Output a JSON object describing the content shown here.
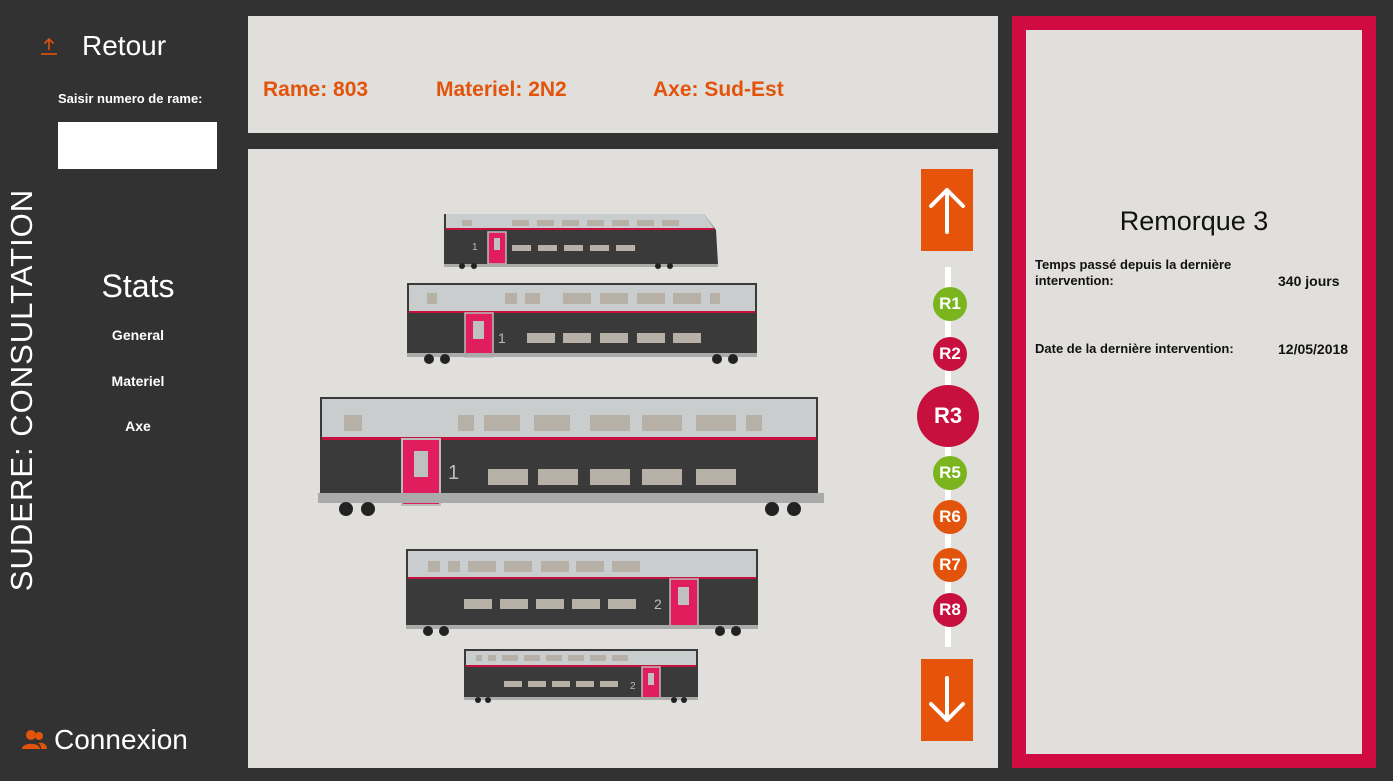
{
  "sidebar": {
    "back_label": "Retour",
    "rame_input_label": "Saisir numero de rame:",
    "rame_input_value": "",
    "app_title": "SUDERE: CONSULTATION",
    "stats_title": "Stats",
    "stats_items": [
      "General",
      "Materiel",
      "Axe"
    ],
    "connexion_label": "Connexion"
  },
  "header": {
    "rame": "Rame: 803",
    "materiel": "Materiel: 2N2",
    "axe": "Axe: Sud-Est"
  },
  "train": {
    "cars": [
      {
        "number": "1"
      },
      {
        "number": "1"
      },
      {
        "number": "1",
        "selected": true
      },
      {
        "number": "2"
      },
      {
        "number": "2"
      }
    ],
    "selector": [
      {
        "label": "R1",
        "color": "#7ab51d"
      },
      {
        "label": "R2",
        "color": "#c8103e"
      },
      {
        "label": "R3",
        "color": "#c8103e",
        "selected": true
      },
      {
        "label": "R5",
        "color": "#7ab51d"
      },
      {
        "label": "R6",
        "color": "#e2530b"
      },
      {
        "label": "R7",
        "color": "#e2530b"
      },
      {
        "label": "R8",
        "color": "#c8103e"
      }
    ]
  },
  "detail": {
    "title": "Remorque 3",
    "rows": [
      {
        "label": "Temps passé depuis la dernière intervention:",
        "value": "340 jours"
      },
      {
        "label": "Date de la dernière intervention:",
        "value": "12/05/2018"
      }
    ]
  },
  "colors": {
    "accent": "#e2530b",
    "brand_red": "#cf0b42",
    "panel": "#e1dfdb",
    "background": "#323232"
  },
  "icons": {
    "back": "upload-arrow-icon",
    "connexion": "users-icon",
    "up": "arrow-up-icon",
    "down": "arrow-down-icon"
  }
}
